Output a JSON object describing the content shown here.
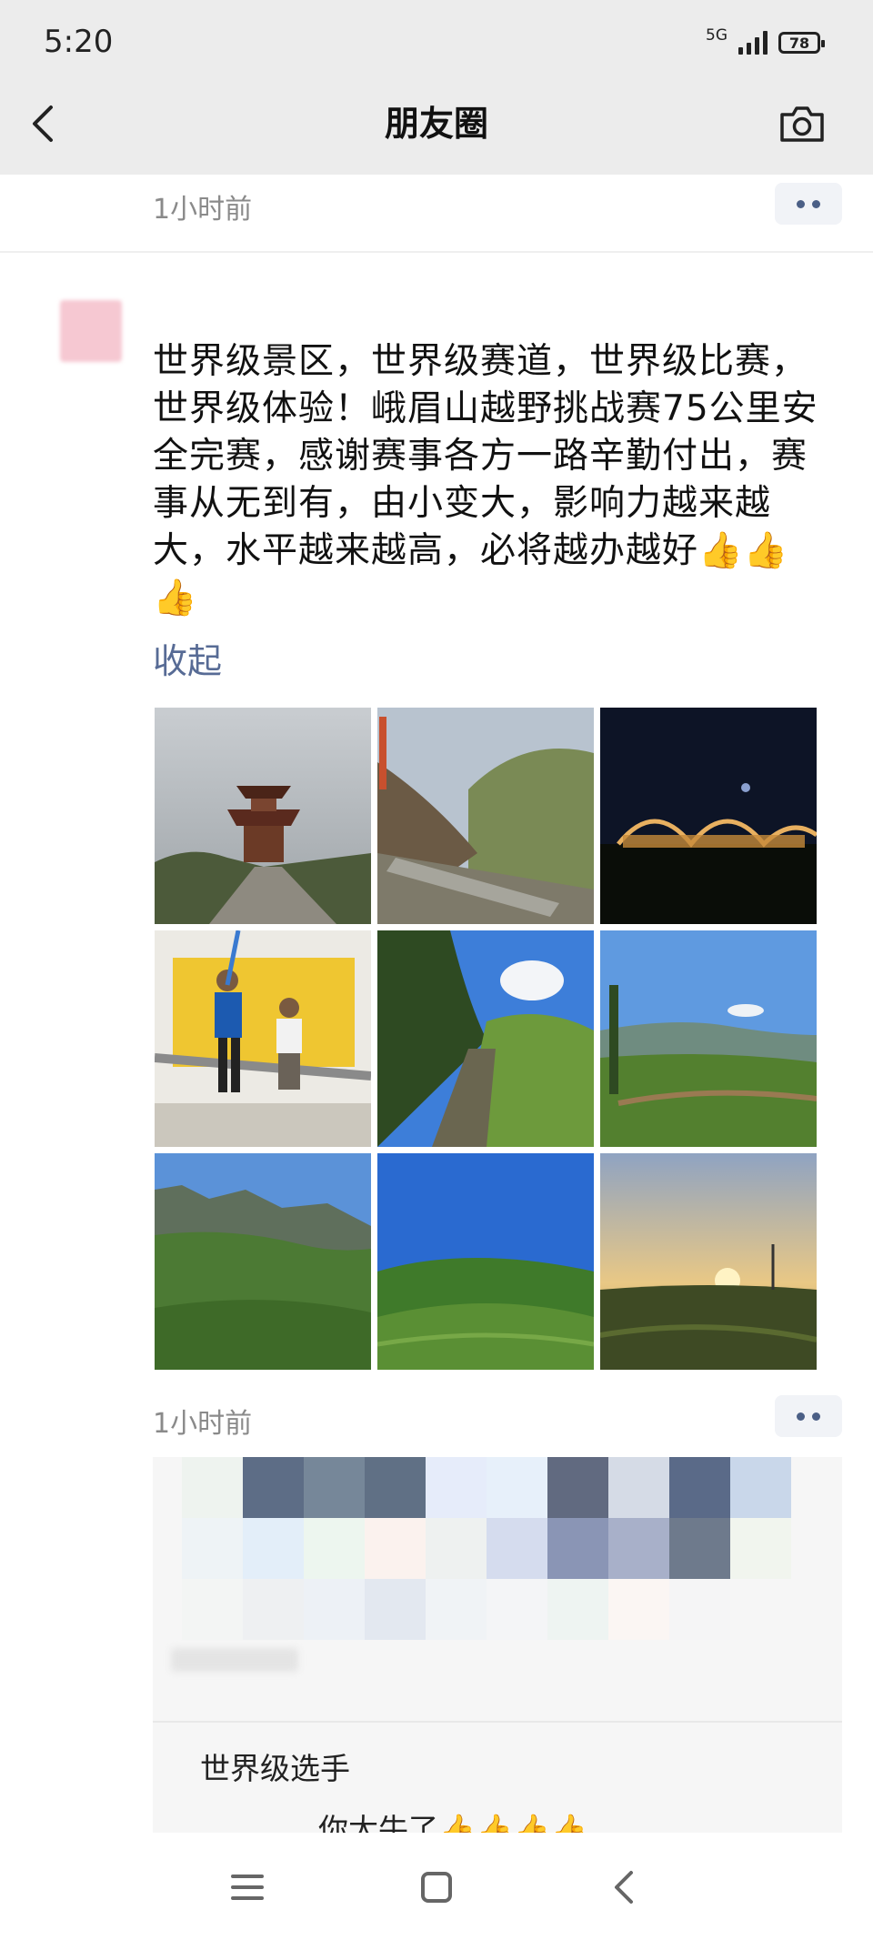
{
  "status_bar": {
    "time": "5:20",
    "network": "5G",
    "battery": "78"
  },
  "header": {
    "title": "朋友圈",
    "back_icon": "chevron-left-icon",
    "camera_icon": "camera-icon"
  },
  "previous_post": {
    "time": "1小时前"
  },
  "post": {
    "text": "世界级景区，世界级赛道，世界级比赛，世界级体验！峨眉山越野挑战赛75公里安全完赛，感谢赛事各方一路辛勤付出，赛事从无到有，由小变大，影响力越来越大，水平越来越高，必将越办越好👍👍👍",
    "collapse_label": "收起",
    "time": "1小时前",
    "photos": [
      "pavilion",
      "mountain-trail",
      "night-lights",
      "finish-line",
      "forest-steps",
      "valley",
      "peaks",
      "tea-hill",
      "sunset"
    ]
  },
  "comments": {
    "line1": "世界级选手",
    "line2": "你太牛了👍👍👍👍"
  },
  "nav": {
    "menu_icon": "menu-icon",
    "home_icon": "home-square-icon",
    "back_icon": "back-triangle-icon"
  }
}
